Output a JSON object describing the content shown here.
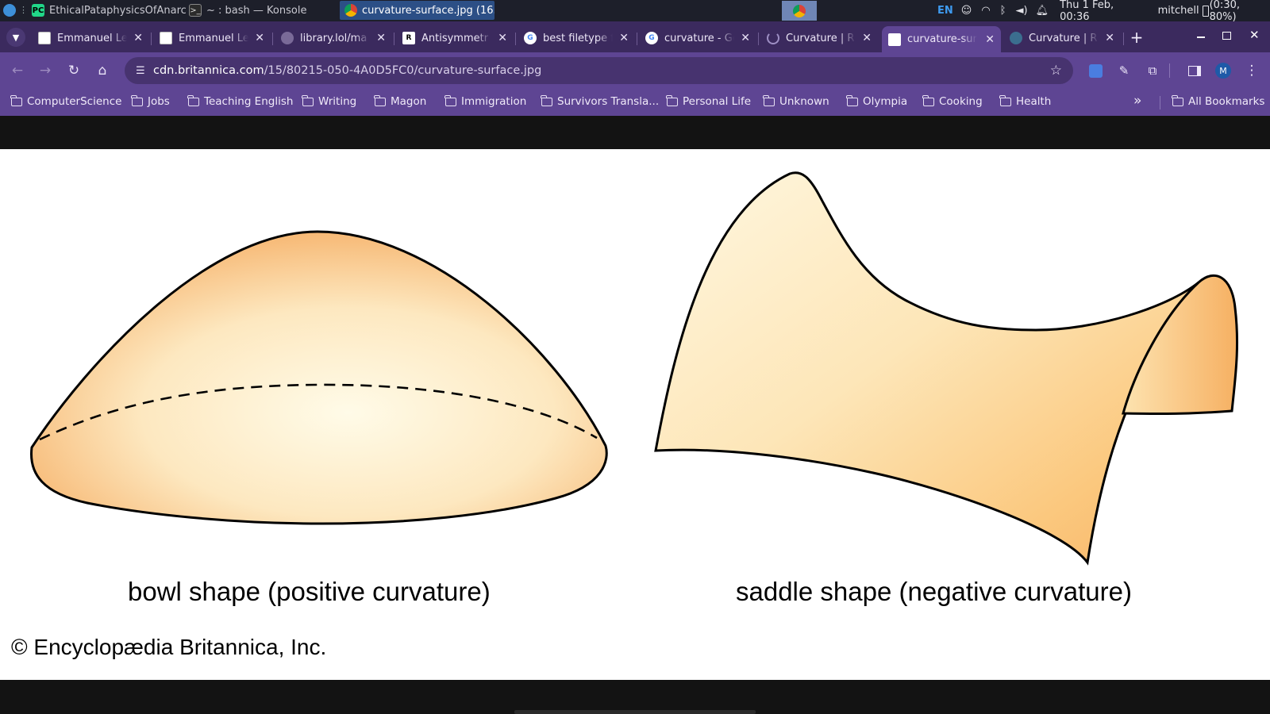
{
  "taskbar": {
    "windows": [
      {
        "title": "EthicalPataphysicsOfAnarc..."
      },
      {
        "title": "~ : bash — Konsole"
      },
      {
        "title": "curvature-surface.jpg (16..."
      }
    ],
    "tray": {
      "language": "EN",
      "clock": "Thu 1 Feb, 00:36",
      "user": "mitchell",
      "battery": "(0:30, 80%)"
    }
  },
  "browser": {
    "tabs": [
      {
        "title": "Emmanuel Le"
      },
      {
        "title": "Emmanuel Le"
      },
      {
        "title": "library.lol/ma"
      },
      {
        "title": "Antisymmetr"
      },
      {
        "title": "best filetype f"
      },
      {
        "title": "curvature - Go"
      },
      {
        "title": "Curvature | R"
      },
      {
        "title": "curvature-sur"
      },
      {
        "title": "Curvature | R"
      }
    ],
    "active_tab_index": 7,
    "address": {
      "host": "cdn.britannica.com",
      "path": "/15/80215-050-4A0D5FC0/curvature-surface.jpg"
    },
    "profile_initial": "M",
    "bookmarks": [
      {
        "label": "ComputerScience"
      },
      {
        "label": "Jobs"
      },
      {
        "label": "Teaching English"
      },
      {
        "label": "Writing"
      },
      {
        "label": "Magon"
      },
      {
        "label": "Immigration"
      },
      {
        "label": "Survivors Transla..."
      },
      {
        "label": "Personal Life"
      },
      {
        "label": "Unknown"
      },
      {
        "label": "Olympia"
      },
      {
        "label": "Cooking"
      },
      {
        "label": "Health"
      }
    ],
    "all_bookmarks_label": "All Bookmarks",
    "more_bookmarks_glyph": "»"
  },
  "image": {
    "captions": {
      "bowl": "bowl shape (positive curvature)",
      "saddle": "saddle shape (negative curvature)"
    },
    "credit": "© Encyclopædia Britannica, Inc.",
    "colors": {
      "surface_light": "#fff4d6",
      "surface_dark": "#f7b56a",
      "outline": "#000000"
    }
  },
  "colors": {
    "taskbar": "#1d1f2a",
    "tabstrip": "#3b2a5e",
    "toolbar": "#5e4593",
    "omnibox": "#47336f"
  }
}
